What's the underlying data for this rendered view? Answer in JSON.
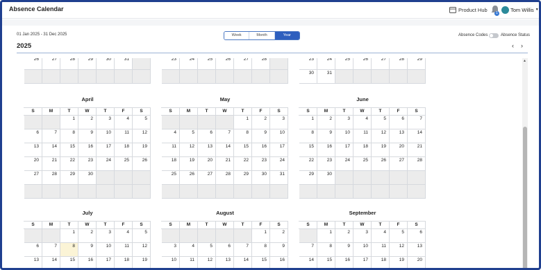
{
  "header": {
    "title": "Absence Calendar",
    "product_hub": "Product Hub",
    "notification_count": "1",
    "user_name": "Tom Willis"
  },
  "toolbar": {
    "date_range": "01 Jan 2025 - 31 Dec 2025",
    "year": "2025",
    "views": [
      "Week",
      "Month",
      "Year"
    ],
    "active_view": "Year",
    "absence_codes_label": "Absence Codes",
    "absence_status_label": "Absence Status",
    "absence_status_enabled": false
  },
  "weekday_headers": [
    "S",
    "M",
    "T",
    "W",
    "T",
    "F",
    "S"
  ],
  "today": {
    "month": "July",
    "day": 8
  },
  "months": [
    {
      "name": "",
      "weeks": [
        [
          "26",
          "27",
          "28",
          "29",
          "30",
          "31",
          ""
        ],
        [
          "",
          "",
          "",
          "",
          "",
          "",
          ""
        ]
      ]
    },
    {
      "name": "",
      "weeks": [
        [
          "23",
          "24",
          "25",
          "26",
          "27",
          "28",
          ""
        ],
        [
          "",
          "",
          "",
          "",
          "",
          "",
          ""
        ]
      ]
    },
    {
      "name": "",
      "weeks": [
        [
          "23",
          "24",
          "25",
          "26",
          "27",
          "28",
          "29"
        ],
        [
          "30",
          "31",
          "",
          "",
          "",
          "",
          ""
        ]
      ]
    },
    {
      "name": "April",
      "weeks": [
        [
          "",
          "",
          "1",
          "2",
          "3",
          "4",
          "5"
        ],
        [
          "6",
          "7",
          "8",
          "9",
          "10",
          "11",
          "12"
        ],
        [
          "13",
          "14",
          "15",
          "16",
          "17",
          "18",
          "19"
        ],
        [
          "20",
          "21",
          "22",
          "23",
          "24",
          "25",
          "26"
        ],
        [
          "27",
          "28",
          "29",
          "30",
          "",
          "",
          ""
        ],
        [
          "",
          "",
          "",
          "",
          "",
          "",
          ""
        ]
      ]
    },
    {
      "name": "May",
      "weeks": [
        [
          "",
          "",
          "",
          "",
          "1",
          "2",
          "3"
        ],
        [
          "4",
          "5",
          "6",
          "7",
          "8",
          "9",
          "10"
        ],
        [
          "11",
          "12",
          "13",
          "14",
          "15",
          "16",
          "17"
        ],
        [
          "18",
          "19",
          "20",
          "21",
          "22",
          "23",
          "24"
        ],
        [
          "25",
          "26",
          "27",
          "28",
          "29",
          "30",
          "31"
        ],
        [
          "",
          "",
          "",
          "",
          "",
          "",
          ""
        ]
      ]
    },
    {
      "name": "June",
      "weeks": [
        [
          "1",
          "2",
          "3",
          "4",
          "5",
          "6",
          "7"
        ],
        [
          "8",
          "9",
          "10",
          "11",
          "12",
          "13",
          "14"
        ],
        [
          "15",
          "16",
          "17",
          "18",
          "19",
          "20",
          "21"
        ],
        [
          "22",
          "23",
          "24",
          "25",
          "26",
          "27",
          "28"
        ],
        [
          "29",
          "30",
          "",
          "",
          "",
          "",
          ""
        ],
        [
          "",
          "",
          "",
          "",
          "",
          "",
          ""
        ]
      ]
    },
    {
      "name": "July",
      "weeks": [
        [
          "",
          "",
          "1",
          "2",
          "3",
          "4",
          "5"
        ],
        [
          "6",
          "7",
          "8",
          "9",
          "10",
          "11",
          "12"
        ],
        [
          "13",
          "14",
          "15",
          "16",
          "17",
          "18",
          "19"
        ]
      ]
    },
    {
      "name": "August",
      "weeks": [
        [
          "",
          "",
          "",
          "",
          "",
          "1",
          "2"
        ],
        [
          "3",
          "4",
          "5",
          "6",
          "7",
          "8",
          "9"
        ],
        [
          "10",
          "11",
          "12",
          "13",
          "14",
          "15",
          "16"
        ]
      ]
    },
    {
      "name": "September",
      "weeks": [
        [
          "",
          "1",
          "2",
          "3",
          "4",
          "5",
          "6"
        ],
        [
          "7",
          "8",
          "9",
          "10",
          "11",
          "12",
          "13"
        ],
        [
          "14",
          "15",
          "16",
          "17",
          "18",
          "19",
          "20"
        ]
      ]
    }
  ]
}
